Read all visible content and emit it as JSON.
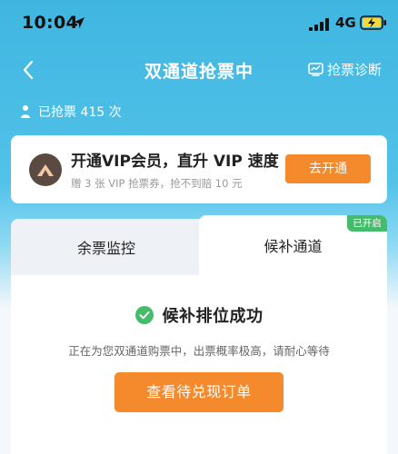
{
  "status_bar": {
    "time": "10:04",
    "network": "4G",
    "location_icon": "location-arrow-icon",
    "signal_icon": "signal-bars-icon",
    "battery_icon": "battery-charging-icon"
  },
  "nav": {
    "title": "双通道抢票中",
    "back_icon": "chevron-left-icon",
    "diagnose_label": "抢票诊断",
    "diagnose_icon": "chart-monitor-icon"
  },
  "grab": {
    "count_text": "已抢票 415 次"
  },
  "vip": {
    "title": "开通VIP会员，直升 VIP 速度",
    "subtitle": "赠 3 张 VIP 抢票券，抢不到赔 10 元",
    "button_label": "去开通"
  },
  "tabs": [
    {
      "label": "余票监控",
      "active": false
    },
    {
      "label": "候补通道",
      "active": true,
      "badge": "已开启"
    }
  ],
  "result": {
    "title": "候补排位成功",
    "message": "正在为您双通道购票中，出票概率极高，请耐心等待",
    "button_label": "查看待兑现订单"
  },
  "colors": {
    "header_blue": "#3fb6e0",
    "accent_orange": "#f48a2c",
    "success_green": "#44bc6a"
  }
}
